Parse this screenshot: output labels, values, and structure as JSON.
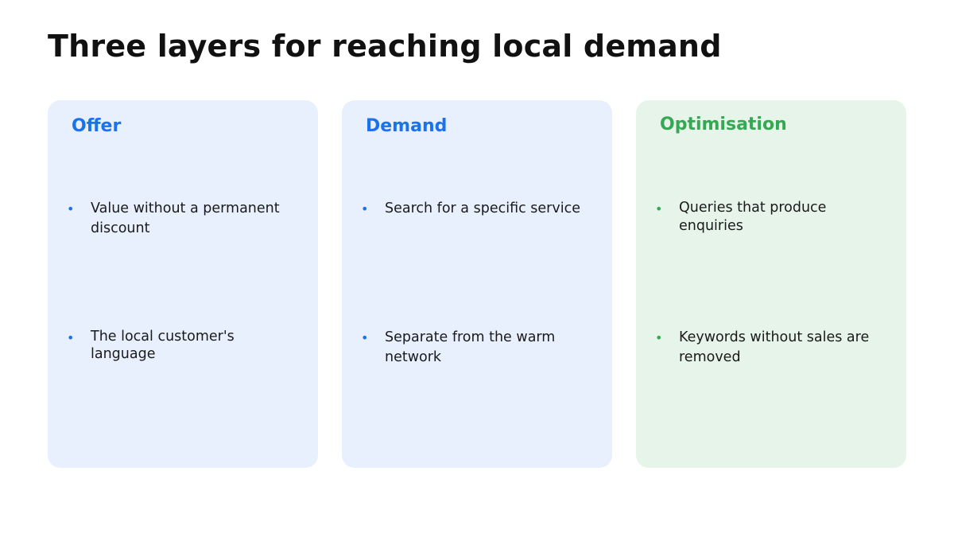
{
  "slide": {
    "title": "Three layers for reaching local demand"
  },
  "colors": {
    "blue_accent": "#1a73e8",
    "green_accent": "#34a853",
    "blue_card_bg": "#e8f0fe",
    "green_card_bg": "#e6f4ea",
    "title_text": "#111111",
    "body_text": "#1a1a1a"
  },
  "cards": [
    {
      "title": "Offer",
      "accent": "#1a73e8",
      "bullet_glyph": "•",
      "bullets": [
        "Value without a permanent discount",
        "The local customer's language"
      ]
    },
    {
      "title": "Demand",
      "accent": "#1a73e8",
      "bullet_glyph": "•",
      "bullets": [
        "Search for a specific service",
        "Separate from the warm network"
      ]
    },
    {
      "title": "Optimisation",
      "accent": "#34a853",
      "bullet_glyph": "•",
      "bullets": [
        "Queries that produce enquiries",
        "Keywords without sales are removed"
      ]
    }
  ]
}
